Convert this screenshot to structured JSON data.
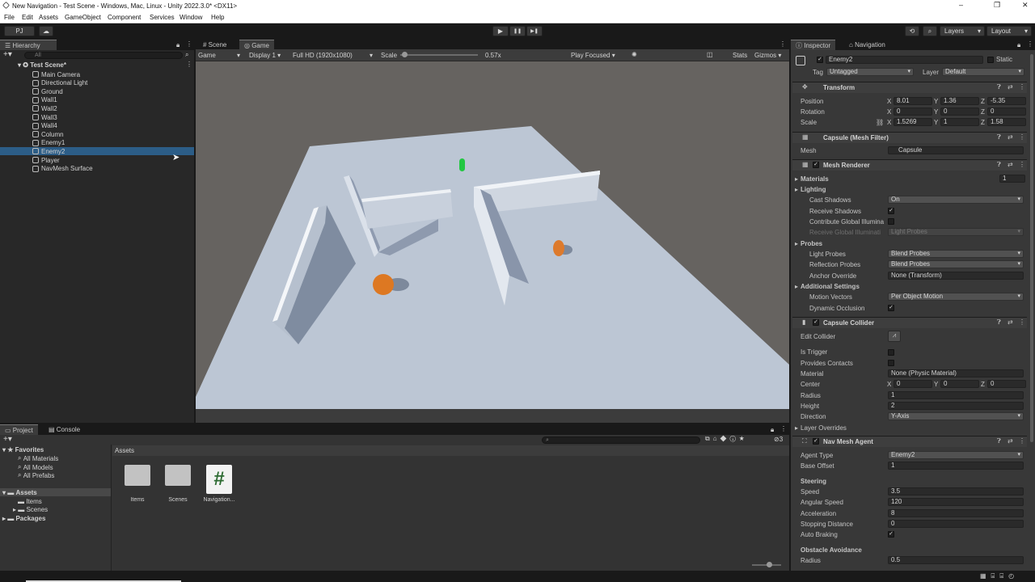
{
  "window": {
    "title": "New Navigation - Test Scene - Windows, Mac, Linux - Unity 2022.3.0* <DX11>",
    "min": "–",
    "max": "❐",
    "close": "✕"
  },
  "menu": [
    "File",
    "Edit",
    "Assets",
    "GameObject",
    "Component",
    "Services",
    "Window",
    "Help"
  ],
  "toolbar": {
    "account": "PJ",
    "layers": "Layers",
    "layout": "Layout",
    "play": "▶",
    "pause": "❚❚",
    "step": "▶❚"
  },
  "hierarchy": {
    "tab": "Hierarchy",
    "search_placeholder": "All",
    "scene": "Test Scene*",
    "items": [
      "Main Camera",
      "Directional Light",
      "Ground",
      "Wall1",
      "Wall2",
      "Wall3",
      "Wall4",
      "Column",
      "Enemy1",
      "Enemy2",
      "Player",
      "NavMesh Surface"
    ],
    "selected": "Enemy2"
  },
  "game": {
    "tab_scene": "Scene",
    "tab_game": "Game",
    "mode": "Game",
    "display": "Display 1",
    "resolution": "Full HD (1920x1080)",
    "scale_label": "Scale",
    "scale_value": "0.57x",
    "play_focused": "Play Focused",
    "stats": "Stats",
    "gizmos": "Gizmos",
    "scale_fraction": 0.02
  },
  "project": {
    "tab_project": "Project",
    "tab_console": "Console",
    "favorites": "Favorites",
    "fav_items": [
      "All Materials",
      "All Models",
      "All Prefabs"
    ],
    "assets": "Assets",
    "asset_children": [
      "Items",
      "Scenes"
    ],
    "packages": "Packages",
    "breadcrumb": "Assets",
    "files": [
      "Items",
      "Scenes",
      "Navigation..."
    ],
    "badge_count": "3"
  },
  "inspector": {
    "tab_inspector": "Inspector",
    "tab_navigation": "Navigation",
    "object_name": "Enemy2",
    "static_label": "Static",
    "tag_label": "Tag",
    "tag_value": "Untagged",
    "layer_label": "Layer",
    "layer_value": "Default",
    "transform": {
      "title": "Transform",
      "position_label": "Position",
      "rotation_label": "Rotation",
      "scale_label": "Scale",
      "pos": [
        "8.01",
        "1.36",
        "-5.35"
      ],
      "rot": [
        "0",
        "0",
        "0"
      ],
      "scl": [
        "1.5269",
        "1",
        "1.58"
      ]
    },
    "mesh_filter": {
      "title": "Capsule (Mesh Filter)",
      "mesh_label": "Mesh",
      "mesh_value": "Capsule"
    },
    "mesh_renderer": {
      "title": "Mesh Renderer",
      "materials_label": "Materials",
      "materials_count": "1",
      "lighting": "Lighting",
      "cast_shadows_label": "Cast Shadows",
      "cast_shadows": "On",
      "receive_shadows_label": "Receive Shadows",
      "contribute_gi_label": "Contribute Global Illumina",
      "receive_gi_label": "Receive Global Illuminati",
      "receive_gi_value": "Light Probes",
      "probes": "Probes",
      "light_probes_label": "Light Probes",
      "light_probes": "Blend Probes",
      "reflection_probes_label": "Reflection Probes",
      "reflection_probes": "Blend Probes",
      "anchor_label": "Anchor Override",
      "anchor_value": "None (Transform)",
      "additional": "Additional Settings",
      "motion_label": "Motion Vectors",
      "motion_value": "Per Object Motion",
      "dyn_occ_label": "Dynamic Occlusion"
    },
    "collider": {
      "title": "Capsule Collider",
      "edit_label": "Edit Collider",
      "trigger_label": "Is Trigger",
      "contacts_label": "Provides Contacts",
      "material_label": "Material",
      "material_value": "None (Physic Material)",
      "center_label": "Center",
      "center": [
        "0",
        "0",
        "0"
      ],
      "radius_label": "Radius",
      "radius": "1",
      "height_label": "Height",
      "height": "2",
      "direction_label": "Direction",
      "direction": "Y-Axis",
      "overrides_label": "Layer Overrides"
    },
    "agent": {
      "title": "Nav Mesh Agent",
      "type_label": "Agent Type",
      "type_value": "Enemy2",
      "offset_label": "Base Offset",
      "offset": "1",
      "steering": "Steering",
      "speed_label": "Speed",
      "speed": "3.5",
      "ang_label": "Angular Speed",
      "ang": "120",
      "accel_label": "Acceleration",
      "accel": "8",
      "stop_label": "Stopping Distance",
      "stop": "0",
      "brake_label": "Auto Braking",
      "avoid": "Obstacle Avoidance",
      "radius_label": "Radius",
      "radius": "0.5"
    }
  },
  "axis": {
    "x": "X",
    "y": "Y",
    "z": "Z"
  },
  "check": "✓"
}
